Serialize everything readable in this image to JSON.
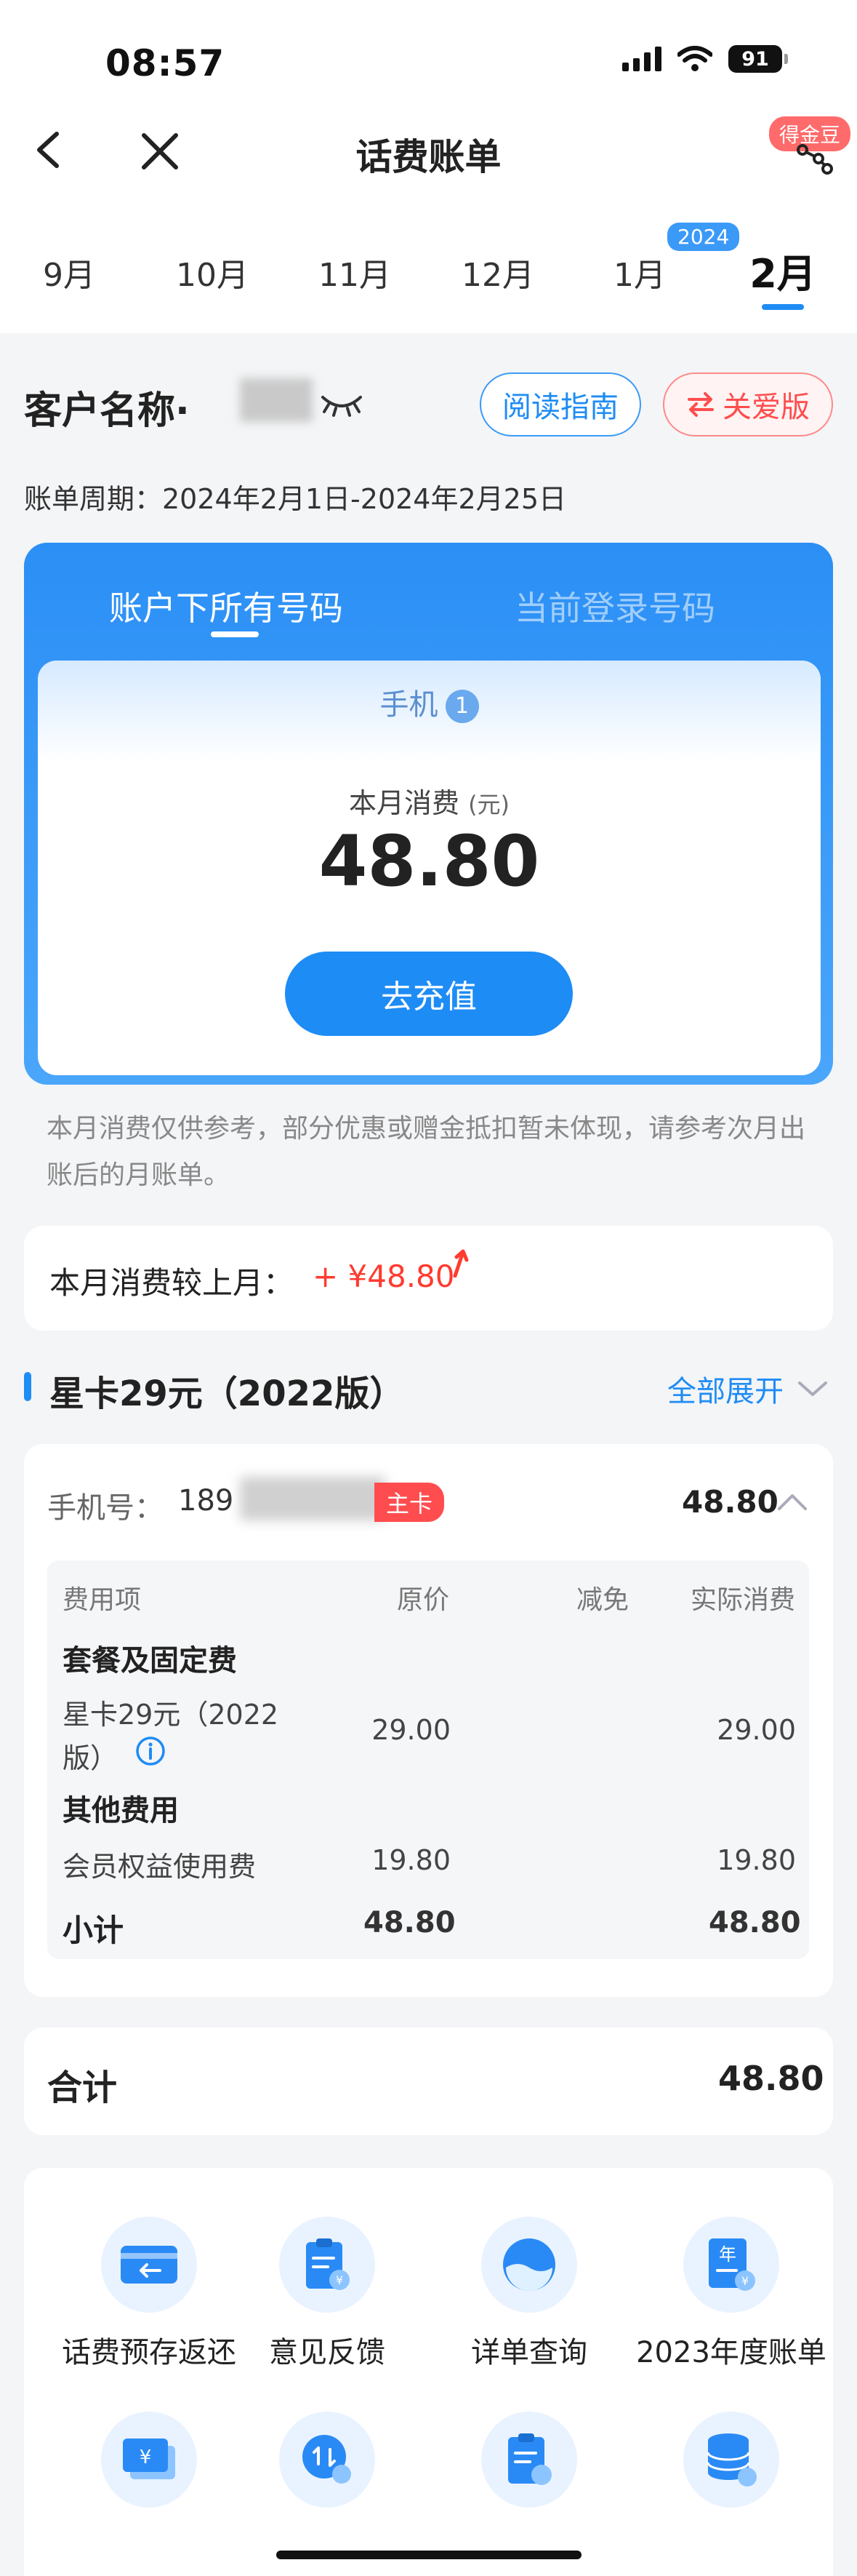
{
  "status": {
    "time": "08:57",
    "battery": "91"
  },
  "header": {
    "title": "话费账单",
    "jindou_label": "得金豆"
  },
  "months": {
    "items": [
      "9月",
      "10月",
      "11月",
      "12月",
      "1月",
      "2月"
    ],
    "year_badge": "2024",
    "active": "2月"
  },
  "customer": {
    "label": "客户名称·",
    "guide_button": "阅读指南",
    "care_button": "关爱版",
    "period": "账单周期：2024年2月1日-2024年2月25日"
  },
  "account": {
    "tab_all": "账户下所有号码",
    "tab_current": "当前登录号码",
    "phone_tab": "手机",
    "phone_count": "1",
    "month_fee_label": "本月消费",
    "month_fee_unit": "(元)",
    "month_fee_value": "48.80",
    "recharge_button": "去充值",
    "note": "本月消费仅供参考，部分优惠或赠金抵扣暂未体现，请参考次月出账后的月账单。"
  },
  "compare": {
    "label": "本月消费较上月：",
    "value": "+ ¥48.80"
  },
  "plan": {
    "title": "星卡29元（2022版）",
    "expand_all": "全部展开",
    "phone_label": "手机号：",
    "phone_number": "189",
    "main_badge": "主卡",
    "phone_total": "48.80",
    "table": {
      "headers": [
        "费用项",
        "原价",
        "减免",
        "实际消费"
      ],
      "group1": "套餐及固定费",
      "row1_name_line1": "星卡29元（2022",
      "row1_name_line2": "版）",
      "row1_price": "29.00",
      "row1_actual": "29.00",
      "group2": "其他费用",
      "row2_name": "会员权益使用费",
      "row2_price": "19.80",
      "row2_actual": "19.80",
      "subtotal_label": "小计",
      "subtotal_price": "48.80",
      "subtotal_actual": "48.80"
    }
  },
  "total": {
    "label": "合计",
    "value": "48.80"
  },
  "services": [
    {
      "label": "话费预存返还",
      "icon": "card-return-icon"
    },
    {
      "label": "意见反馈",
      "icon": "feedback-clipboard-icon"
    },
    {
      "label": "详单查询",
      "icon": "detail-query-icon"
    },
    {
      "label": "2023年度账单",
      "icon": "annual-bill-icon"
    }
  ],
  "colors": {
    "accent": "#1e8cf5",
    "danger": "#ff4d4f",
    "background": "#f4f5f7"
  }
}
